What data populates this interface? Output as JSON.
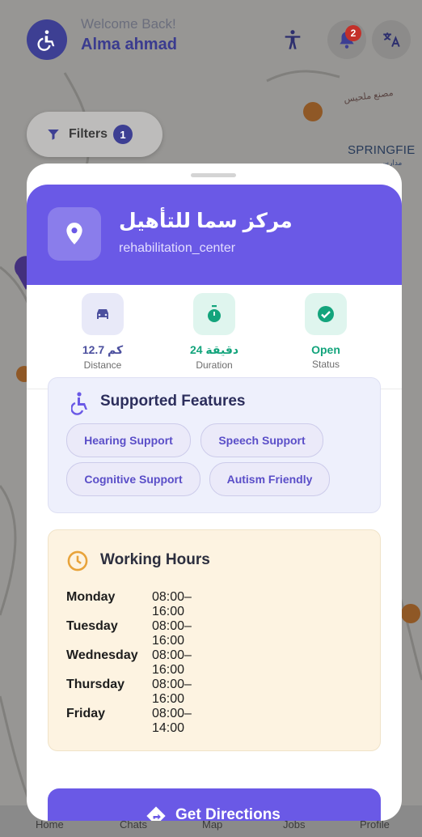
{
  "header": {
    "welcome": "Welcome Back!",
    "username": "Alma ahmad",
    "notification_count": "2"
  },
  "map": {
    "filters_label": "Filters",
    "filters_count": "1",
    "place_label": "SPRINGFIE",
    "place_label_ar": "مصنع ملحيس",
    "place_label_ar2": "مدارس"
  },
  "nav": {
    "items": [
      "Home",
      "Chats",
      "Map",
      "Jobs",
      "Profile"
    ]
  },
  "center": {
    "name": "مركز سما للتأهيل",
    "type": "rehabilitation_center"
  },
  "stats": [
    {
      "value": "12.7 كم",
      "label": "Distance",
      "icon": "car-icon",
      "color": "#4b4f9e",
      "tile": "#e8e9f8"
    },
    {
      "value": "24 دقيقة",
      "label": "Duration",
      "icon": "timer-icon",
      "color": "#13a47c",
      "tile": "#dff5ee"
    },
    {
      "value": "Open",
      "label": "Status",
      "icon": "check-circle-icon",
      "color": "#13a47c",
      "tile": "#dff5ee"
    }
  ],
  "features": {
    "title": "Supported Features",
    "chips": [
      "Hearing Support",
      "Speech Support",
      "Cognitive Support",
      "Autism Friendly"
    ]
  },
  "hours": {
    "title": "Working Hours",
    "rows": [
      {
        "day": "Monday",
        "time": "08:00–16:00"
      },
      {
        "day": "Tuesday",
        "time": "08:00–16:00"
      },
      {
        "day": "Wednesday",
        "time": "08:00–16:00"
      },
      {
        "day": "Thursday",
        "time": "08:00–16:00"
      },
      {
        "day": "Friday",
        "time": "08:00–14:00"
      }
    ]
  },
  "directions_label": "Get Directions",
  "colors": {
    "primary": "#6a59e6",
    "navy": "#3d3f93",
    "green": "#13a47c",
    "hours_bg": "#fdf3e1",
    "clock": "#e8a33a"
  }
}
